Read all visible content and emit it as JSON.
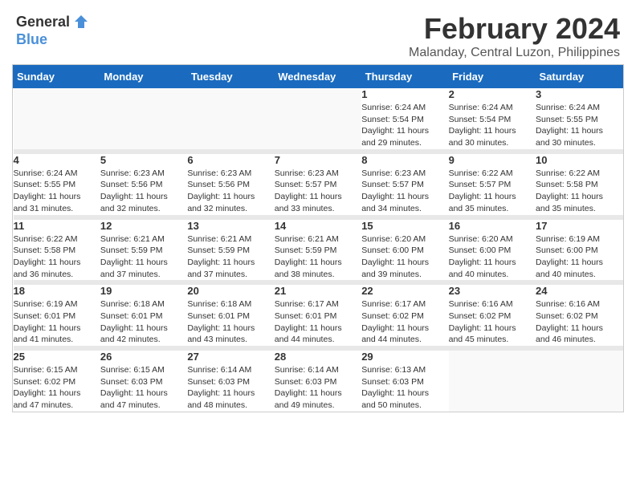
{
  "header": {
    "logo_general": "General",
    "logo_blue": "Blue",
    "month_year": "February 2024",
    "location": "Malanday, Central Luzon, Philippines"
  },
  "days_of_week": [
    "Sunday",
    "Monday",
    "Tuesday",
    "Wednesday",
    "Thursday",
    "Friday",
    "Saturday"
  ],
  "weeks": [
    [
      {
        "day": "",
        "info": ""
      },
      {
        "day": "",
        "info": ""
      },
      {
        "day": "",
        "info": ""
      },
      {
        "day": "",
        "info": ""
      },
      {
        "day": "1",
        "info": "Sunrise: 6:24 AM\nSunset: 5:54 PM\nDaylight: 11 hours\nand 29 minutes."
      },
      {
        "day": "2",
        "info": "Sunrise: 6:24 AM\nSunset: 5:54 PM\nDaylight: 11 hours\nand 30 minutes."
      },
      {
        "day": "3",
        "info": "Sunrise: 6:24 AM\nSunset: 5:55 PM\nDaylight: 11 hours\nand 30 minutes."
      }
    ],
    [
      {
        "day": "4",
        "info": "Sunrise: 6:24 AM\nSunset: 5:55 PM\nDaylight: 11 hours\nand 31 minutes."
      },
      {
        "day": "5",
        "info": "Sunrise: 6:23 AM\nSunset: 5:56 PM\nDaylight: 11 hours\nand 32 minutes."
      },
      {
        "day": "6",
        "info": "Sunrise: 6:23 AM\nSunset: 5:56 PM\nDaylight: 11 hours\nand 32 minutes."
      },
      {
        "day": "7",
        "info": "Sunrise: 6:23 AM\nSunset: 5:57 PM\nDaylight: 11 hours\nand 33 minutes."
      },
      {
        "day": "8",
        "info": "Sunrise: 6:23 AM\nSunset: 5:57 PM\nDaylight: 11 hours\nand 34 minutes."
      },
      {
        "day": "9",
        "info": "Sunrise: 6:22 AM\nSunset: 5:57 PM\nDaylight: 11 hours\nand 35 minutes."
      },
      {
        "day": "10",
        "info": "Sunrise: 6:22 AM\nSunset: 5:58 PM\nDaylight: 11 hours\nand 35 minutes."
      }
    ],
    [
      {
        "day": "11",
        "info": "Sunrise: 6:22 AM\nSunset: 5:58 PM\nDaylight: 11 hours\nand 36 minutes."
      },
      {
        "day": "12",
        "info": "Sunrise: 6:21 AM\nSunset: 5:59 PM\nDaylight: 11 hours\nand 37 minutes."
      },
      {
        "day": "13",
        "info": "Sunrise: 6:21 AM\nSunset: 5:59 PM\nDaylight: 11 hours\nand 37 minutes."
      },
      {
        "day": "14",
        "info": "Sunrise: 6:21 AM\nSunset: 5:59 PM\nDaylight: 11 hours\nand 38 minutes."
      },
      {
        "day": "15",
        "info": "Sunrise: 6:20 AM\nSunset: 6:00 PM\nDaylight: 11 hours\nand 39 minutes."
      },
      {
        "day": "16",
        "info": "Sunrise: 6:20 AM\nSunset: 6:00 PM\nDaylight: 11 hours\nand 40 minutes."
      },
      {
        "day": "17",
        "info": "Sunrise: 6:19 AM\nSunset: 6:00 PM\nDaylight: 11 hours\nand 40 minutes."
      }
    ],
    [
      {
        "day": "18",
        "info": "Sunrise: 6:19 AM\nSunset: 6:01 PM\nDaylight: 11 hours\nand 41 minutes."
      },
      {
        "day": "19",
        "info": "Sunrise: 6:18 AM\nSunset: 6:01 PM\nDaylight: 11 hours\nand 42 minutes."
      },
      {
        "day": "20",
        "info": "Sunrise: 6:18 AM\nSunset: 6:01 PM\nDaylight: 11 hours\nand 43 minutes."
      },
      {
        "day": "21",
        "info": "Sunrise: 6:17 AM\nSunset: 6:01 PM\nDaylight: 11 hours\nand 44 minutes."
      },
      {
        "day": "22",
        "info": "Sunrise: 6:17 AM\nSunset: 6:02 PM\nDaylight: 11 hours\nand 44 minutes."
      },
      {
        "day": "23",
        "info": "Sunrise: 6:16 AM\nSunset: 6:02 PM\nDaylight: 11 hours\nand 45 minutes."
      },
      {
        "day": "24",
        "info": "Sunrise: 6:16 AM\nSunset: 6:02 PM\nDaylight: 11 hours\nand 46 minutes."
      }
    ],
    [
      {
        "day": "25",
        "info": "Sunrise: 6:15 AM\nSunset: 6:02 PM\nDaylight: 11 hours\nand 47 minutes."
      },
      {
        "day": "26",
        "info": "Sunrise: 6:15 AM\nSunset: 6:03 PM\nDaylight: 11 hours\nand 47 minutes."
      },
      {
        "day": "27",
        "info": "Sunrise: 6:14 AM\nSunset: 6:03 PM\nDaylight: 11 hours\nand 48 minutes."
      },
      {
        "day": "28",
        "info": "Sunrise: 6:14 AM\nSunset: 6:03 PM\nDaylight: 11 hours\nand 49 minutes."
      },
      {
        "day": "29",
        "info": "Sunrise: 6:13 AM\nSunset: 6:03 PM\nDaylight: 11 hours\nand 50 minutes."
      },
      {
        "day": "",
        "info": ""
      },
      {
        "day": "",
        "info": ""
      }
    ]
  ]
}
